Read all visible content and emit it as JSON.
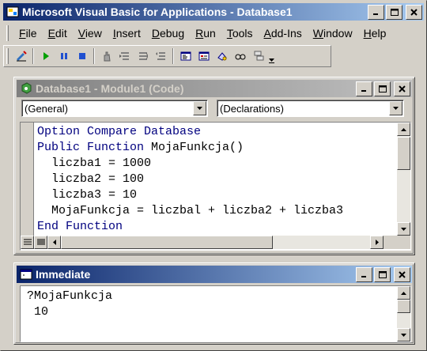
{
  "app": {
    "title": "Microsoft Visual Basic for Applications - Database1"
  },
  "menu": [
    "File",
    "Edit",
    "View",
    "Insert",
    "Debug",
    "Run",
    "Tools",
    "Add-Ins",
    "Window",
    "Help"
  ],
  "menu_mnemonics": [
    "F",
    "E",
    "V",
    "I",
    "D",
    "R",
    "T",
    "A",
    "W",
    "H"
  ],
  "toolbar": {
    "icons": [
      "design-mode-icon",
      "run-icon",
      "break-icon",
      "reset-icon",
      "toggle-breakpoint-icon",
      "step-into-icon",
      "step-over-icon",
      "step-out-icon",
      "project-explorer-icon",
      "properties-window-icon",
      "object-browser-icon",
      "watch-icon",
      "call-stack-icon"
    ]
  },
  "code_window": {
    "title": "Database1 - Module1 (Code)",
    "object_combo": "(General)",
    "procedure_combo": "(Declarations)",
    "lines": [
      {
        "kw": "Option Compare Database",
        "rest": ""
      },
      {
        "kw": "Public Function",
        "rest": " MojaFunkcja()"
      },
      {
        "kw": "",
        "rest": "  liczba1 = 1000"
      },
      {
        "kw": "",
        "rest": "  liczba2 = 100"
      },
      {
        "kw": "",
        "rest": "  liczba3 = 10"
      },
      {
        "kw": "",
        "rest": "  MojaFunkcja = liczbal + liczba2 + liczba3"
      },
      {
        "kw": "End Function",
        "rest": ""
      }
    ]
  },
  "immediate_window": {
    "title": "Immediate",
    "lines": [
      "?MojaFunkcja",
      " 10"
    ]
  },
  "colors": {
    "keyword": "#00007f",
    "titlebar_active": "#0a246a",
    "titlebar_inactive": "#808080"
  }
}
